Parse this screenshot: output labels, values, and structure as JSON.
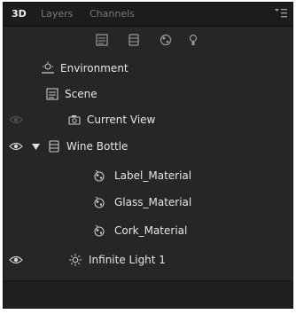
{
  "tabs": [
    {
      "label": "3D",
      "active": true
    },
    {
      "label": "Layers",
      "active": false
    },
    {
      "label": "Channels",
      "active": false
    }
  ],
  "toolbar": {
    "icons": [
      "scene-filter-icon",
      "mesh-filter-icon",
      "material-filter-icon",
      "light-filter-icon"
    ]
  },
  "tree": {
    "environment": {
      "label": "Environment",
      "icon": "environment-icon"
    },
    "scene": {
      "label": "Scene",
      "icon": "scene-icon"
    },
    "current_view": {
      "label": "Current View",
      "icon": "camera-icon"
    },
    "wine_bottle": {
      "label": "Wine Bottle",
      "icon": "mesh-icon",
      "expanded": true
    },
    "label_material": {
      "label": "Label_Material",
      "icon": "material-icon"
    },
    "glass_material": {
      "label": "Glass_Material",
      "icon": "material-icon"
    },
    "cork_material": {
      "label": "Cork_Material",
      "icon": "material-icon"
    },
    "infinite_light": {
      "label": "Infinite Light 1",
      "icon": "light-icon"
    }
  },
  "colors": {
    "panel_bg": "#262626",
    "tab_bar_bg": "#1c1c1c",
    "text": "#e6e6e6",
    "tab_inactive": "#7a7a7a"
  }
}
